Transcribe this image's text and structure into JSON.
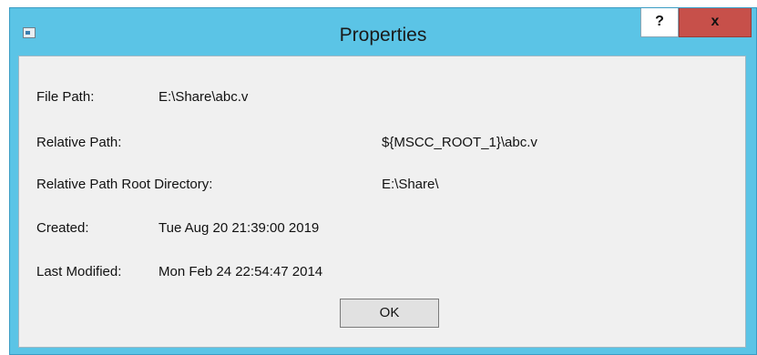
{
  "dialog": {
    "title": "Properties",
    "help_label": "?",
    "close_label": "x"
  },
  "fields": {
    "file_path_label": "File Path:",
    "file_path_value": "E:\\Share\\abc.v",
    "relative_path_label": "Relative Path:",
    "relative_path_value": "${MSCC_ROOT_1}\\abc.v",
    "root_dir_label": "Relative Path Root Directory:",
    "root_dir_value": "E:\\Share\\",
    "created_label": "Created:",
    "created_value": "Tue Aug 20 21:39:00 2019",
    "modified_label": "Last Modified:",
    "modified_value": "Mon Feb 24 22:54:47 2014"
  },
  "buttons": {
    "ok_label": "OK"
  },
  "colors": {
    "titlebar": "#5bc4e6",
    "close_button": "#c7504a",
    "client_background": "#f0f0f0"
  }
}
